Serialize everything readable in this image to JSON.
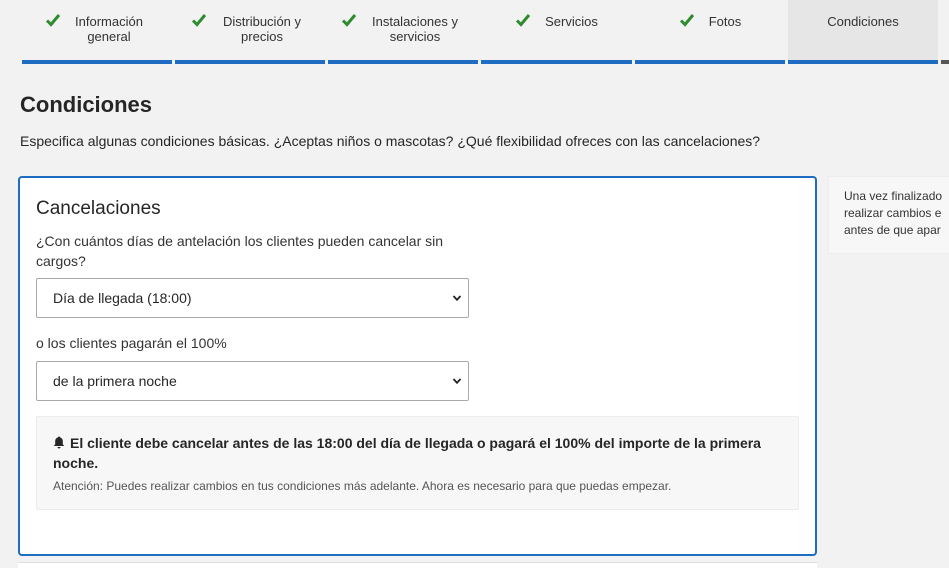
{
  "stepper": {
    "steps": [
      {
        "label": "Información general",
        "done": true
      },
      {
        "label": "Distribución y precios",
        "done": true
      },
      {
        "label": "Instalaciones y servicios",
        "done": true
      },
      {
        "label": "Servicios",
        "done": true
      },
      {
        "label": "Fotos",
        "done": true
      },
      {
        "label": "Condiciones",
        "done": false
      }
    ]
  },
  "page": {
    "title": "Condiciones",
    "intro": "Especifica algunas condiciones básicas. ¿Aceptas niños o mascotas? ¿Qué flexibilidad ofreces con las cancelaciones?"
  },
  "cancellations": {
    "title": "Cancelaciones",
    "question": "¿Con cuántos días de antelación los clientes pueden cancelar sin cargos?",
    "deadline_value": "Día de llegada (18:00)",
    "fee_label": "o los clientes pagarán el 100%",
    "fee_value": "de la primera noche",
    "notice_text": "El cliente debe cancelar antes de las 18:00 del día de llegada o pagará el 100% del importe de la primera noche.",
    "notice_small": "Atención: Puedes realizar cambios en tus condiciones más adelante. Ahora es necesario para que puedas empezar."
  },
  "sidebar": {
    "line1": "Una vez finalizado",
    "line2": "realizar cambios e",
    "line3": "antes de que apar"
  },
  "colors": {
    "accent": "#1f6dc2",
    "check": "#2e8b2e"
  }
}
